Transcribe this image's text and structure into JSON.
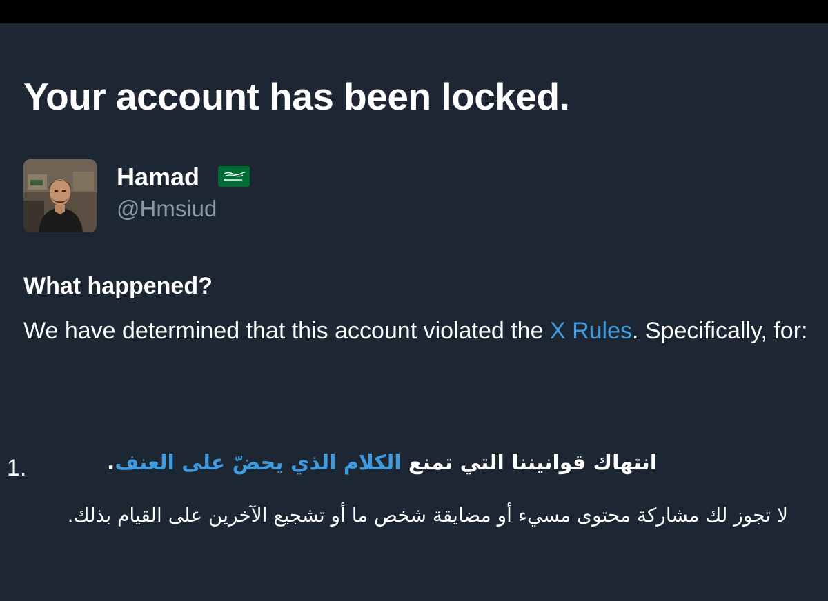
{
  "headline": "Your account has been locked.",
  "account": {
    "display_name": "Hamad",
    "flag_icon": "saudi-arabia-flag-icon",
    "handle": "@Hmsiud"
  },
  "section": {
    "title": "What happened?",
    "body_before_link": "We have determined that this account violated the ",
    "link_text": "X Rules",
    "body_after_link": ". Specifically, for:"
  },
  "violations": [
    {
      "number": "1.",
      "title_prefix": "انتهاك قوانيننا التي تمنع ",
      "title_link": "الكلام الذي يحضّ على العنف",
      "title_suffix": ".",
      "description": "لا تجوز لك مشاركة محتوى مسيء أو مضايقة شخص ما أو تشجيع الآخرين على القيام بذلك."
    }
  ],
  "colors": {
    "background": "#1c2733",
    "top_strip": "#000000",
    "text": "#ffffff",
    "secondary_text": "#8899a6",
    "link": "#3f9bdd"
  }
}
